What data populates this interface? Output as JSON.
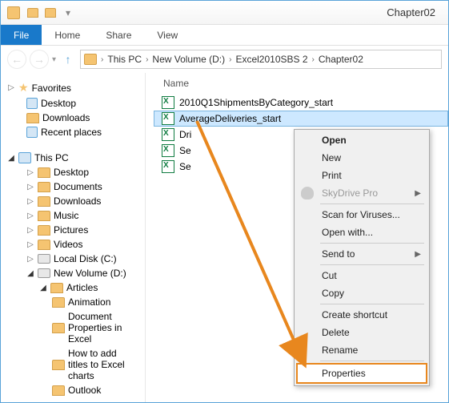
{
  "window": {
    "title": "Chapter02"
  },
  "ribbon": {
    "file": "File",
    "tabs": [
      "Home",
      "Share",
      "View"
    ]
  },
  "breadcrumb": [
    "This PC",
    "New Volume (D:)",
    "Excel2010SBS 2",
    "Chapter02"
  ],
  "nav": {
    "favorites": {
      "label": "Favorites",
      "items": [
        "Desktop",
        "Downloads",
        "Recent places"
      ]
    },
    "thispc": {
      "label": "This PC",
      "items": [
        "Desktop",
        "Documents",
        "Downloads",
        "Music",
        "Pictures",
        "Videos"
      ],
      "drives": [
        {
          "label": "Local Disk (C:)",
          "open": false
        },
        {
          "label": "New Volume (D:)",
          "open": true,
          "children": [
            {
              "label": "Articles",
              "open": true,
              "children": [
                "Animation",
                "Document Properties in Excel",
                "How to add titles to Excel charts",
                "Outlook"
              ]
            }
          ]
        }
      ]
    }
  },
  "files": {
    "column": "Name",
    "items": [
      "2010Q1ShipmentsByCategory_start",
      "AverageDeliveries_start",
      "Dri",
      "Se",
      "Se"
    ],
    "selectedIndex": 1
  },
  "context": {
    "open": "Open",
    "new": "New",
    "print": "Print",
    "skydrive": "SkyDrive Pro",
    "scan": "Scan for Viruses...",
    "openwith": "Open with...",
    "sendto": "Send to",
    "cut": "Cut",
    "copy": "Copy",
    "shortcut": "Create shortcut",
    "delete": "Delete",
    "rename": "Rename",
    "properties": "Properties"
  }
}
